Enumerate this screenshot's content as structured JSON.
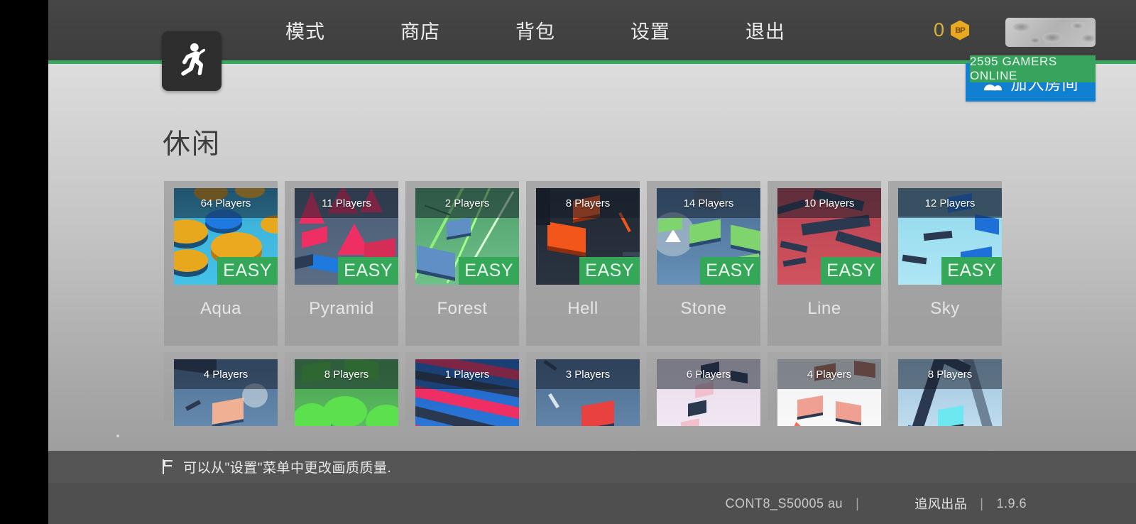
{
  "nav": {
    "items": [
      {
        "label": "模式",
        "name": "nav-item-mode"
      },
      {
        "label": "商店",
        "name": "nav-item-shop"
      },
      {
        "label": "背包",
        "name": "nav-item-backpack"
      },
      {
        "label": "设置",
        "name": "nav-item-settings"
      },
      {
        "label": "退出",
        "name": "nav-item-exit"
      }
    ]
  },
  "header": {
    "logo_icon": "running-man-icon",
    "currency_amount": "0",
    "currency_icon": "bp-coin-icon",
    "currency_symbol": "BP",
    "avatar_placeholder": "loading-avatar-bar",
    "online_badge": "2595 GAMERS ONLINE",
    "online_color": "#37a35c",
    "accent_green": "#3aa85f"
  },
  "page": {
    "title": "休闲",
    "join_button": "加入房间",
    "join_button_icon": "two-people-icon",
    "join_button_color": "#1280d0"
  },
  "maps": {
    "difficulty_color": "#34a758",
    "row1": [
      {
        "name": "Aqua",
        "players": "64 Players",
        "difficulty": "EASY",
        "art": "art-aqua"
      },
      {
        "name": "Pyramid",
        "players": "11 Players",
        "difficulty": "EASY",
        "art": "art-pyramid"
      },
      {
        "name": "Forest",
        "players": "2 Players",
        "difficulty": "EASY",
        "art": "art-forest"
      },
      {
        "name": "Hell",
        "players": "8 Players",
        "difficulty": "EASY",
        "art": "art-hell"
      },
      {
        "name": "Stone",
        "players": "14 Players",
        "difficulty": "EASY",
        "art": "art-stone"
      },
      {
        "name": "Line",
        "players": "10 Players",
        "difficulty": "EASY",
        "art": "art-line"
      },
      {
        "name": "Sky",
        "players": "12 Players",
        "difficulty": "EASY",
        "art": "art-sky"
      }
    ],
    "row2": [
      {
        "players": "4 Players",
        "art": "art-r2a"
      },
      {
        "players": "8 Players",
        "art": "art-r2b"
      },
      {
        "players": "1 Players",
        "art": "art-r2c"
      },
      {
        "players": "3 Players",
        "art": "art-r2d"
      },
      {
        "players": "6 Players",
        "art": "art-r2e"
      },
      {
        "players": "4 Players",
        "art": "art-r2f"
      },
      {
        "players": "8 Players",
        "art": "art-r2g"
      }
    ]
  },
  "hint": {
    "icon": "flag-icon",
    "text": "可以从\"设置\"菜单中更改画质质量."
  },
  "footer": {
    "build": "CONT8_S50005 au",
    "separator1": "|",
    "brand": "追风出品",
    "separator2": "|",
    "version": "1.9.6"
  }
}
